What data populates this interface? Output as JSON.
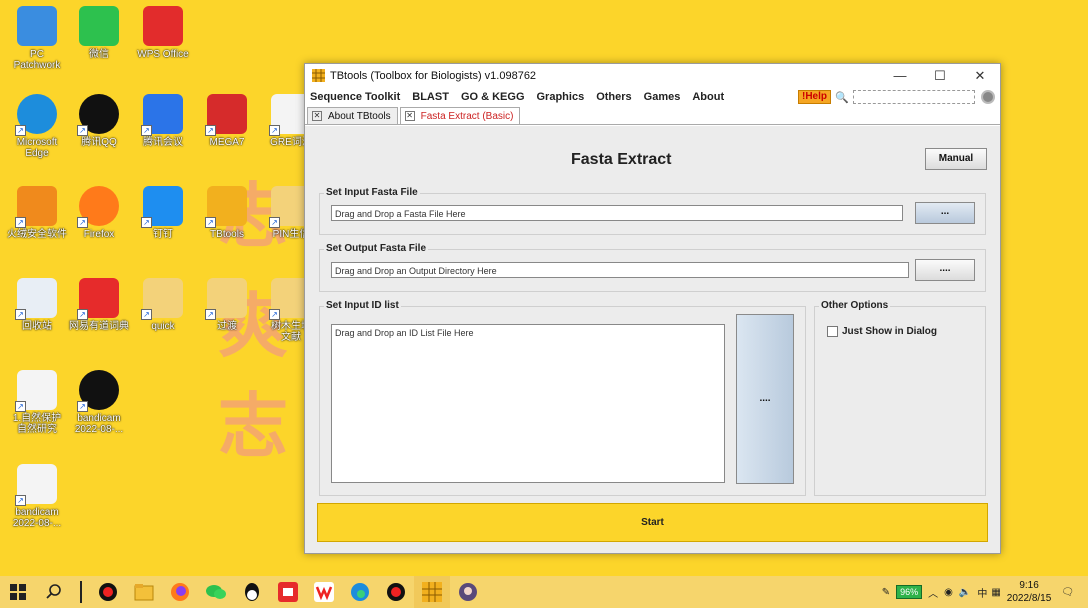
{
  "desktop": {
    "icons": [
      {
        "label": "PC\nPatchwork",
        "icon": "pc-icon"
      },
      {
        "label": "微信",
        "icon": "wechat-icon"
      },
      {
        "label": "WPS Office",
        "icon": "wps-icon"
      },
      {
        "label": "Microsoft\nEdge",
        "icon": "edge-icon"
      },
      {
        "label": "腾讯QQ",
        "icon": "qq-icon"
      },
      {
        "label": "腾讯会议",
        "icon": "meeting-icon"
      },
      {
        "label": "MEGA7",
        "icon": "mega-icon"
      },
      {
        "label": "GRE词汇",
        "icon": "doc-icon"
      },
      {
        "label": "火绒安全软件",
        "icon": "huorong-icon"
      },
      {
        "label": "Firefox",
        "icon": "firefox-icon"
      },
      {
        "label": "钉钉",
        "icon": "dingtalk-icon"
      },
      {
        "label": "TBtools",
        "icon": "tbtools-icon"
      },
      {
        "label": "PIN生信",
        "icon": "folder-icon"
      },
      {
        "label": "回收站",
        "icon": "recycle-bin-icon"
      },
      {
        "label": "网易有道词典",
        "icon": "youdao-icon"
      },
      {
        "label": "quick",
        "icon": "folder-icon"
      },
      {
        "label": "过渡",
        "icon": "folder-icon"
      },
      {
        "label": "树木生境\n文献",
        "icon": "folder-icon"
      },
      {
        "label": "1.自然保护\n自然研究",
        "icon": "video-file-icon"
      },
      {
        "label": "bandicam\n2022-08-...",
        "icon": "bandicam-icon"
      },
      {
        "label": "bandicam\n2022-08-...",
        "icon": "video-file-icon"
      }
    ]
  },
  "window": {
    "title": "TBtools (Toolbox for Biologists) v1.098762",
    "controls": {
      "minimize": "—",
      "maximize": "☐",
      "close": "✕"
    },
    "menu": [
      "Sequence Toolkit",
      "BLAST",
      "GO & KEGG",
      "Graphics",
      "Others",
      "Games",
      "About"
    ],
    "help_label": "!Help",
    "tabs": [
      {
        "label": "About TBtools",
        "active": false
      },
      {
        "label": "Fasta Extract (Basic)",
        "active": true
      }
    ],
    "panel": {
      "title": "Fasta Extract",
      "manual_button": "Manual",
      "input_group": {
        "title": "Set Input Fasta File",
        "placeholder": "Drag and Drop a Fasta File Here",
        "browse": "..."
      },
      "output_group": {
        "title": "Set Output Fasta File",
        "placeholder": "Drag and Drop an Output Directory Here",
        "browse": "...."
      },
      "id_group": {
        "title": "Set Input ID list",
        "placeholder": "Drag and Drop an ID List File Here",
        "browse": "...."
      },
      "options_group": {
        "title": "Other Options",
        "checkbox_label": "Just Show in Dialog",
        "checked": false
      },
      "start_button": "Start"
    }
  },
  "taskbar": {
    "battery": "96%",
    "ime": "中",
    "time": "9:16",
    "date": "2022/8/15"
  },
  "colors": {
    "desktop": "#fcd52a",
    "start_button": "#fcd52a",
    "active_tab_text": "#cc2222"
  }
}
